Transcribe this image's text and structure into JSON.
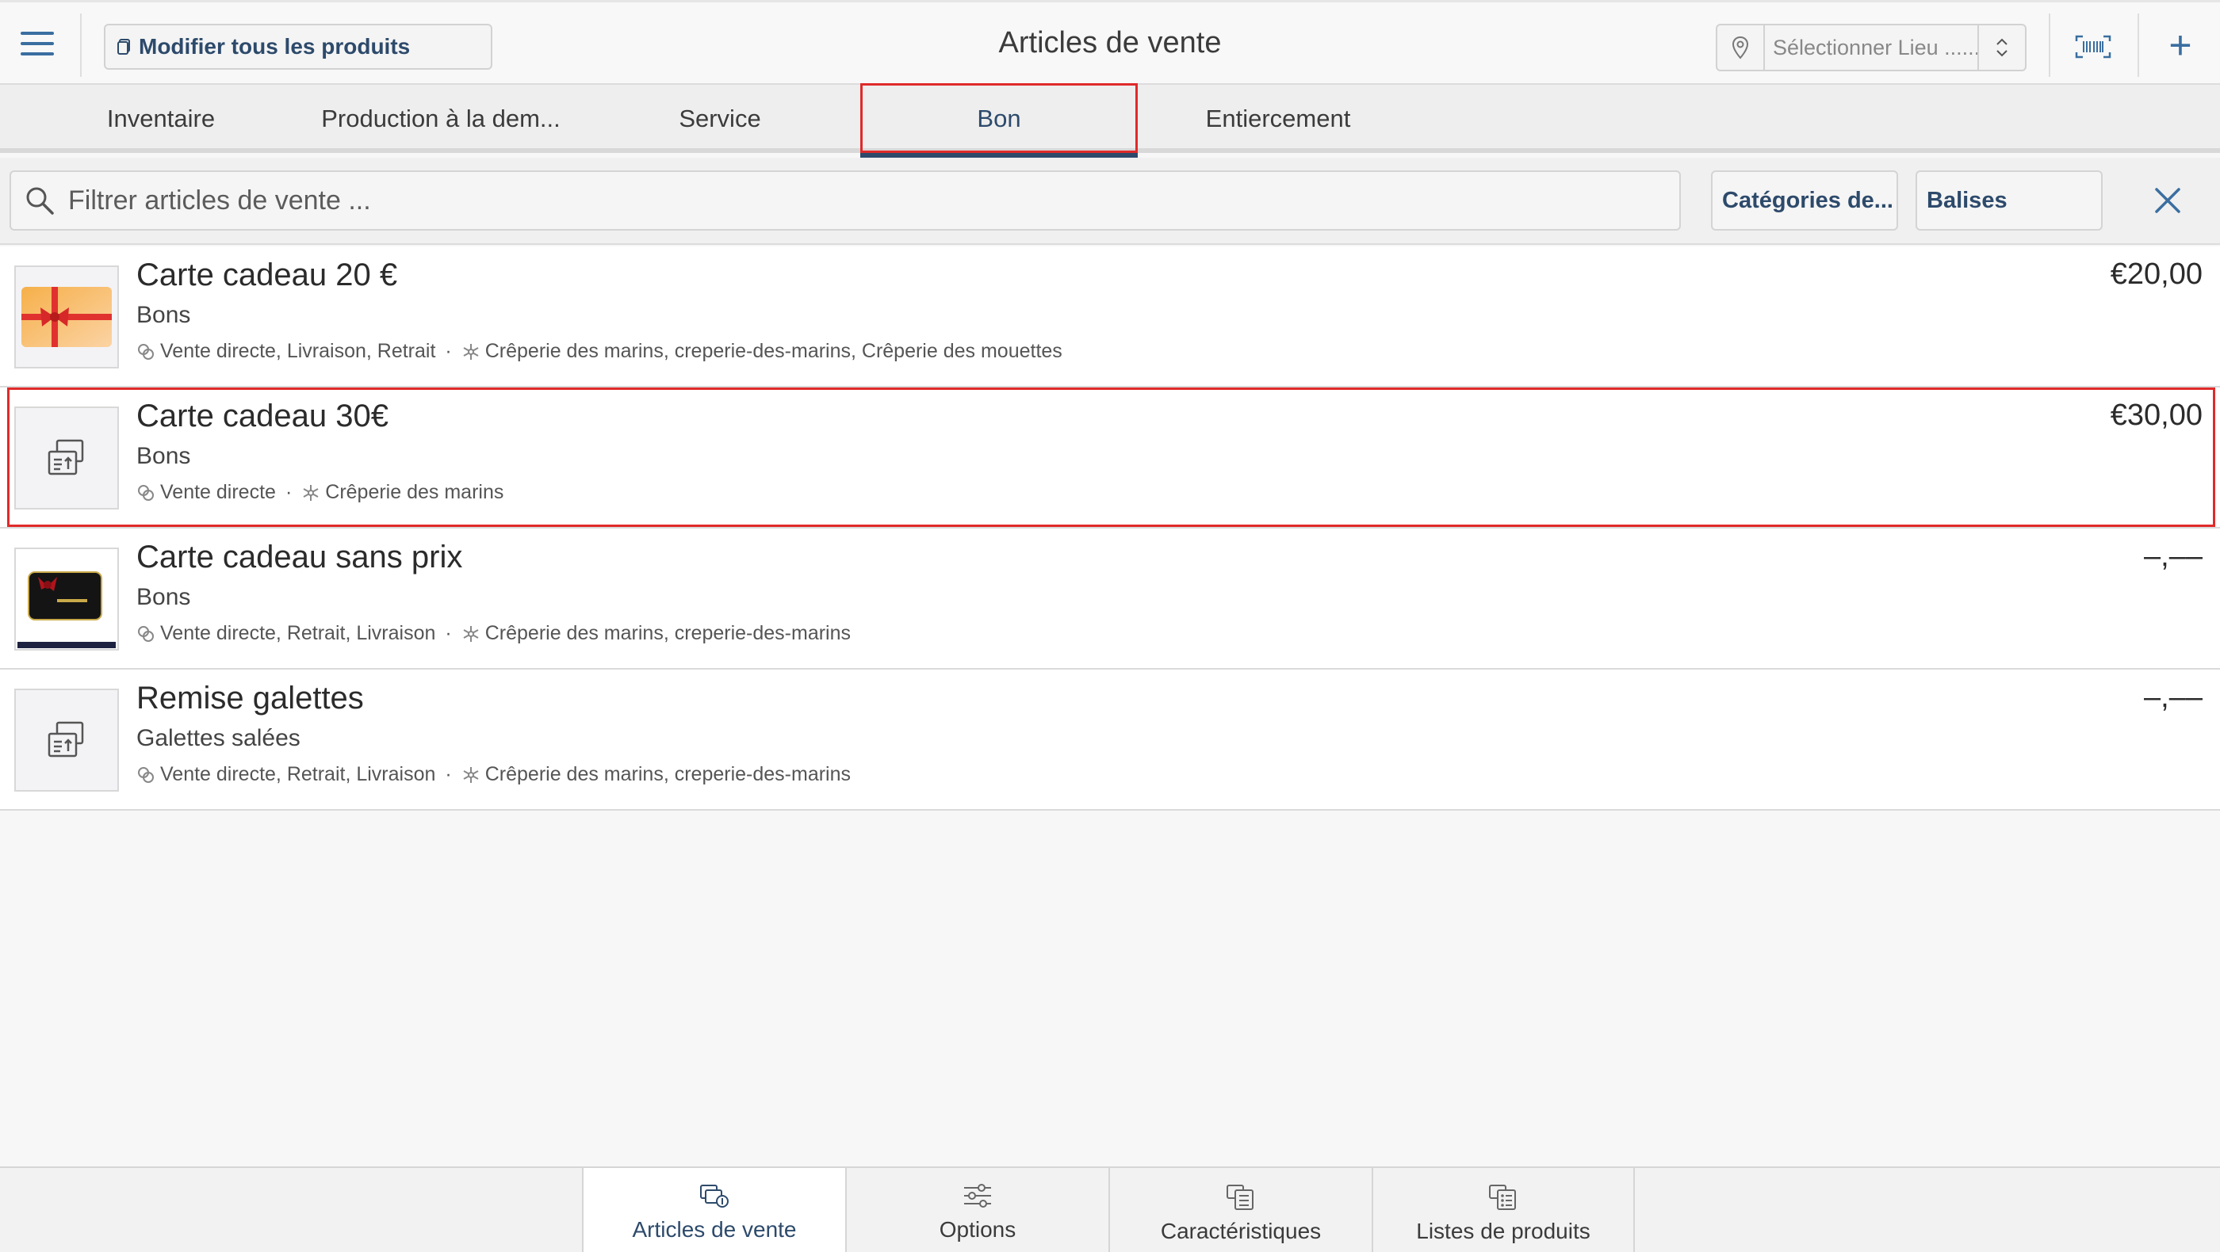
{
  "header": {
    "edit_all_label": "Modifier tous les produits",
    "title": "Articles de vente",
    "location_placeholder": "Sélectionner Lieu ......"
  },
  "tabs": [
    {
      "label": "Inventaire",
      "active": false
    },
    {
      "label": "Production à la dem...",
      "active": false
    },
    {
      "label": "Service",
      "active": false
    },
    {
      "label": "Bon",
      "active": true
    },
    {
      "label": "Entiercement",
      "active": false
    }
  ],
  "filter": {
    "search_placeholder": "Filtrer articles de vente  ...",
    "categories_label": "Catégories de...",
    "tags_label": "Balises"
  },
  "items": [
    {
      "title": "Carte cadeau 20 €",
      "category": "Bons",
      "channels": "Vente directe, Livraison, Retrait",
      "locations": "Crêperie des marins, creperie-des-marins, Crêperie des mouettes",
      "price": "€20,00",
      "thumb": "gift-card-red-ribbon-image"
    },
    {
      "title": "Carte cadeau 30€",
      "category": "Bons",
      "channels": "Vente directe",
      "locations": "Crêperie des marins",
      "price": "€30,00",
      "thumb": "voucher-icon"
    },
    {
      "title": "Carte cadeau sans prix",
      "category": "Bons",
      "channels": "Vente directe, Retrait, Livraison",
      "locations": "Crêperie des marins, creperie-des-marins",
      "price": "–,––",
      "thumb": "black-gift-card-image"
    },
    {
      "title": "Remise galettes",
      "category": "Galettes salées",
      "channels": "Vente directe, Retrait, Livraison",
      "locations": "Crêperie des marins, creperie-des-marins",
      "price": "–,––",
      "thumb": "voucher-icon"
    }
  ],
  "bottom_nav": [
    {
      "label": "Articles de vente",
      "icon": "sale-items-icon",
      "active": true
    },
    {
      "label": "Options",
      "icon": "sliders-icon",
      "active": false
    },
    {
      "label": "Caractéristiques",
      "icon": "features-icon",
      "active": false
    },
    {
      "label": "Listes de produits",
      "icon": "product-lists-icon",
      "active": false
    }
  ],
  "colors": {
    "accent": "#2d4a6b",
    "icon_blue": "#3a6ea0",
    "highlight_red": "#e02a2a"
  }
}
